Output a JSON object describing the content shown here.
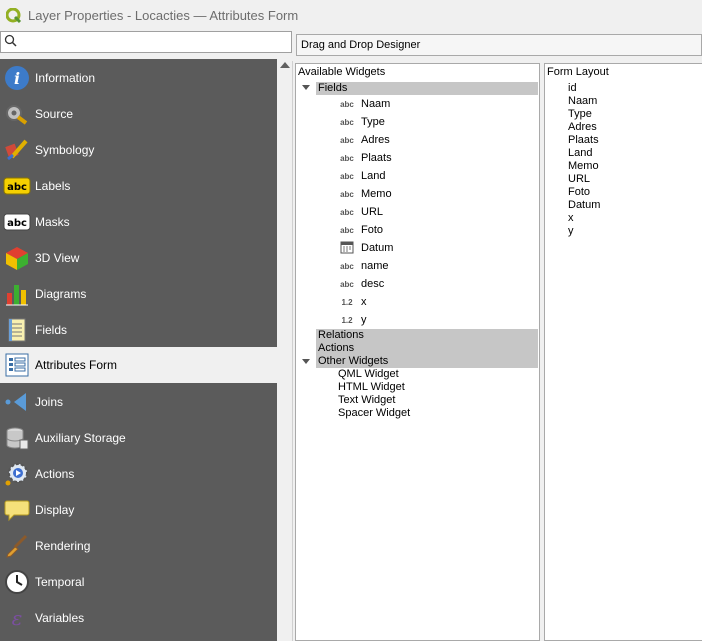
{
  "window": {
    "title": "Layer Properties - Locacties — Attributes Form"
  },
  "search": {
    "placeholder": ""
  },
  "sidebar": {
    "items": [
      {
        "label": "Information",
        "icon": "info-icon"
      },
      {
        "label": "Source",
        "icon": "source-icon"
      },
      {
        "label": "Symbology",
        "icon": "symbology-icon"
      },
      {
        "label": "Labels",
        "icon": "labels-icon"
      },
      {
        "label": "Masks",
        "icon": "masks-icon"
      },
      {
        "label": "3D View",
        "icon": "3d-view-icon"
      },
      {
        "label": "Diagrams",
        "icon": "diagrams-icon"
      },
      {
        "label": "Fields",
        "icon": "fields-icon"
      },
      {
        "label": "Attributes Form",
        "icon": "attributes-form-icon",
        "selected": true
      },
      {
        "label": "Joins",
        "icon": "joins-icon"
      },
      {
        "label": "Auxiliary Storage",
        "icon": "auxiliary-storage-icon"
      },
      {
        "label": "Actions",
        "icon": "actions-icon"
      },
      {
        "label": "Display",
        "icon": "display-icon"
      },
      {
        "label": "Rendering",
        "icon": "rendering-icon"
      },
      {
        "label": "Temporal",
        "icon": "temporal-icon"
      },
      {
        "label": "Variables",
        "icon": "variables-icon"
      }
    ]
  },
  "designer": {
    "mode": "Drag and Drop Designer"
  },
  "available": {
    "header": "Available Widgets",
    "fields_label": "Fields",
    "fields": [
      {
        "type": "abc",
        "name": "Naam"
      },
      {
        "type": "abc",
        "name": "Type"
      },
      {
        "type": "abc",
        "name": "Adres"
      },
      {
        "type": "abc",
        "name": "Plaats"
      },
      {
        "type": "abc",
        "name": "Land"
      },
      {
        "type": "abc",
        "name": "Memo"
      },
      {
        "type": "abc",
        "name": "URL"
      },
      {
        "type": "abc",
        "name": "Foto"
      },
      {
        "type": "date",
        "name": "Datum"
      },
      {
        "type": "abc",
        "name": "name"
      },
      {
        "type": "abc",
        "name": "desc"
      },
      {
        "type": "1.2",
        "name": "x"
      },
      {
        "type": "1.2",
        "name": "y"
      }
    ],
    "relations_label": "Relations",
    "actions_label": "Actions",
    "other_label": "Other Widgets",
    "other": [
      "QML Widget",
      "HTML Widget",
      "Text Widget",
      "Spacer Widget"
    ]
  },
  "layout": {
    "header": "Form Layout",
    "items": [
      "id",
      "Naam",
      "Type",
      "Adres",
      "Plaats",
      "Land",
      "Memo",
      "URL",
      "Foto",
      "Datum",
      "x",
      "y"
    ]
  },
  "colors": {
    "sidebar_bg": "#5b5b5b",
    "selected_bg": "#f0f0f0",
    "group_bg": "#c6c6c6"
  }
}
